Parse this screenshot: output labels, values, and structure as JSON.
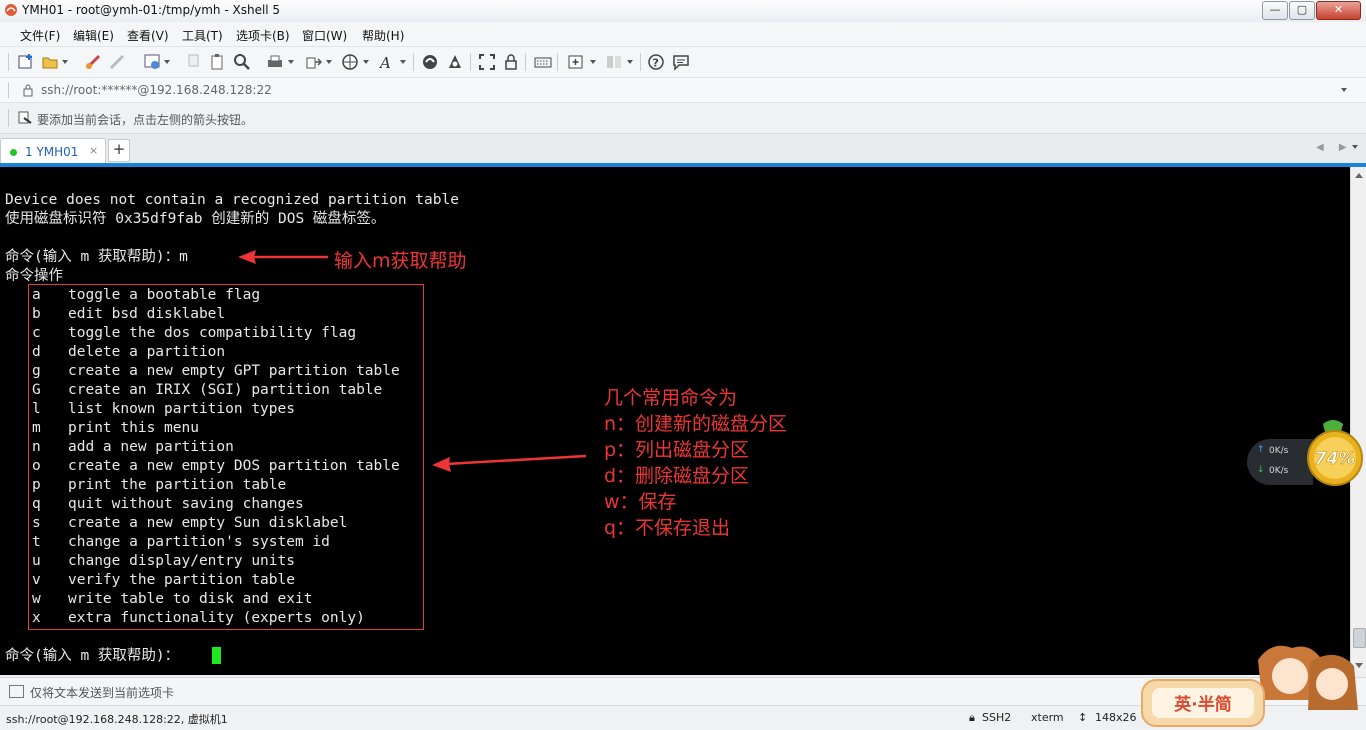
{
  "window": {
    "title": "YMH01 - root@ymh-01:/tmp/ymh - Xshell 5",
    "controls": {
      "minimize": "—",
      "maximize": "▢",
      "close": "✕"
    }
  },
  "menubar": {
    "items": [
      "文件(F)",
      "编辑(E)",
      "查看(V)",
      "工具(T)",
      "选项卡(B)",
      "窗口(W)",
      "帮助(H)"
    ]
  },
  "toolbar": {
    "icons": [
      "new-session-icon",
      "open-folder-icon",
      "connect-icon",
      "disconnect-icon",
      "properties-icon",
      "copy-icon",
      "paste-icon",
      "find-icon",
      "print-icon",
      "transfer-icon",
      "globe-icon",
      "font-icon",
      "xftp-icon",
      "xmanager-icon",
      "fullscreen-icon",
      "lock-icon",
      "keyboard-icon",
      "new-tab-icon",
      "layout-icon",
      "help-icon",
      "chat-icon"
    ]
  },
  "address": {
    "text": "ssh://root:******@192.168.248.128:22"
  },
  "hint": {
    "text": "要添加当前会话，点击左侧的箭头按钮。"
  },
  "tabs": {
    "active_label": "1 YMH01",
    "close": "×",
    "add": "+",
    "nav": "◀ ▶"
  },
  "terminal": {
    "lines": [
      "Device does not contain a recognized partition table",
      "使用磁盘标识符 0x35df9fab 创建新的 DOS 磁盘标签。",
      "",
      "命令(输入 m 获取帮助)：m",
      "命令操作"
    ],
    "options": [
      {
        "key": "a",
        "desc": "toggle a bootable flag"
      },
      {
        "key": "b",
        "desc": "edit bsd disklabel"
      },
      {
        "key": "c",
        "desc": "toggle the dos compatibility flag"
      },
      {
        "key": "d",
        "desc": "delete a partition"
      },
      {
        "key": "g",
        "desc": "create a new empty GPT partition table"
      },
      {
        "key": "G",
        "desc": "create an IRIX (SGI) partition table"
      },
      {
        "key": "l",
        "desc": "list known partition types"
      },
      {
        "key": "m",
        "desc": "print this menu"
      },
      {
        "key": "n",
        "desc": "add a new partition"
      },
      {
        "key": "o",
        "desc": "create a new empty DOS partition table"
      },
      {
        "key": "p",
        "desc": "print the partition table"
      },
      {
        "key": "q",
        "desc": "quit without saving changes"
      },
      {
        "key": "s",
        "desc": "create a new empty Sun disklabel"
      },
      {
        "key": "t",
        "desc": "change a partition's system id"
      },
      {
        "key": "u",
        "desc": "change display/entry units"
      },
      {
        "key": "v",
        "desc": "verify the partition table"
      },
      {
        "key": "w",
        "desc": "write table to disk and exit"
      },
      {
        "key": "x",
        "desc": "extra functionality (experts only)"
      }
    ],
    "prompt": "命令(输入 m 获取帮助)："
  },
  "annotations": {
    "help_note": "输入m获取帮助",
    "common_title": "几个常用命令为",
    "common": [
      "n：创建新的磁盘分区",
      "p：列出磁盘分区",
      "d：删除磁盘分区",
      "w：保存",
      "q：不保存退出"
    ],
    "color": "#ee3535"
  },
  "net_widget": {
    "up": "0K/s",
    "down": "0K/s",
    "percent": "74%"
  },
  "compose": {
    "placeholder": "仅将文本发送到当前选项卡"
  },
  "status": {
    "connection": "ssh://root@192.168.248.128:22, 虚拟机1",
    "protocol": "SSH2",
    "term": "xterm",
    "size": "148x26"
  },
  "ime": {
    "label": "英·半简"
  },
  "colors": {
    "tab_accent": "#1883d7",
    "cursor": "#1fe81f",
    "terminal_bg": "#000000"
  }
}
